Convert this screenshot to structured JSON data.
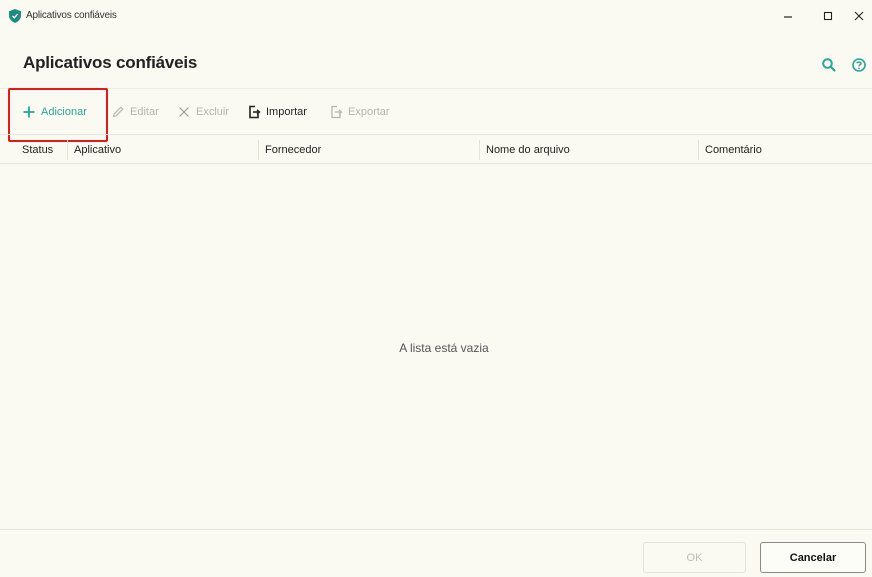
{
  "window": {
    "title": "Aplicativos confiáveis",
    "controls": [
      "minimize",
      "maximize",
      "close"
    ]
  },
  "header": {
    "title": "Aplicativos confiáveis",
    "icons": [
      "search-icon",
      "help-icon"
    ]
  },
  "toolbar": {
    "add_label": "Adicionar",
    "edit_label": "Editar",
    "delete_label": "Excluir",
    "import_label": "Importar",
    "export_label": "Exportar"
  },
  "table": {
    "columns": [
      "Status",
      "Aplicativo",
      "Fornecedor",
      "Nome do arquivo",
      "Comentário"
    ],
    "rows": [],
    "empty_text": "A lista está vazia"
  },
  "footer": {
    "ok_label": "OK",
    "cancel_label": "Cancelar"
  },
  "colors": {
    "accent": "#2aa596",
    "highlight": "#e11a1a",
    "background": "#fbfaf2",
    "disabled": "#b5b5ad"
  }
}
